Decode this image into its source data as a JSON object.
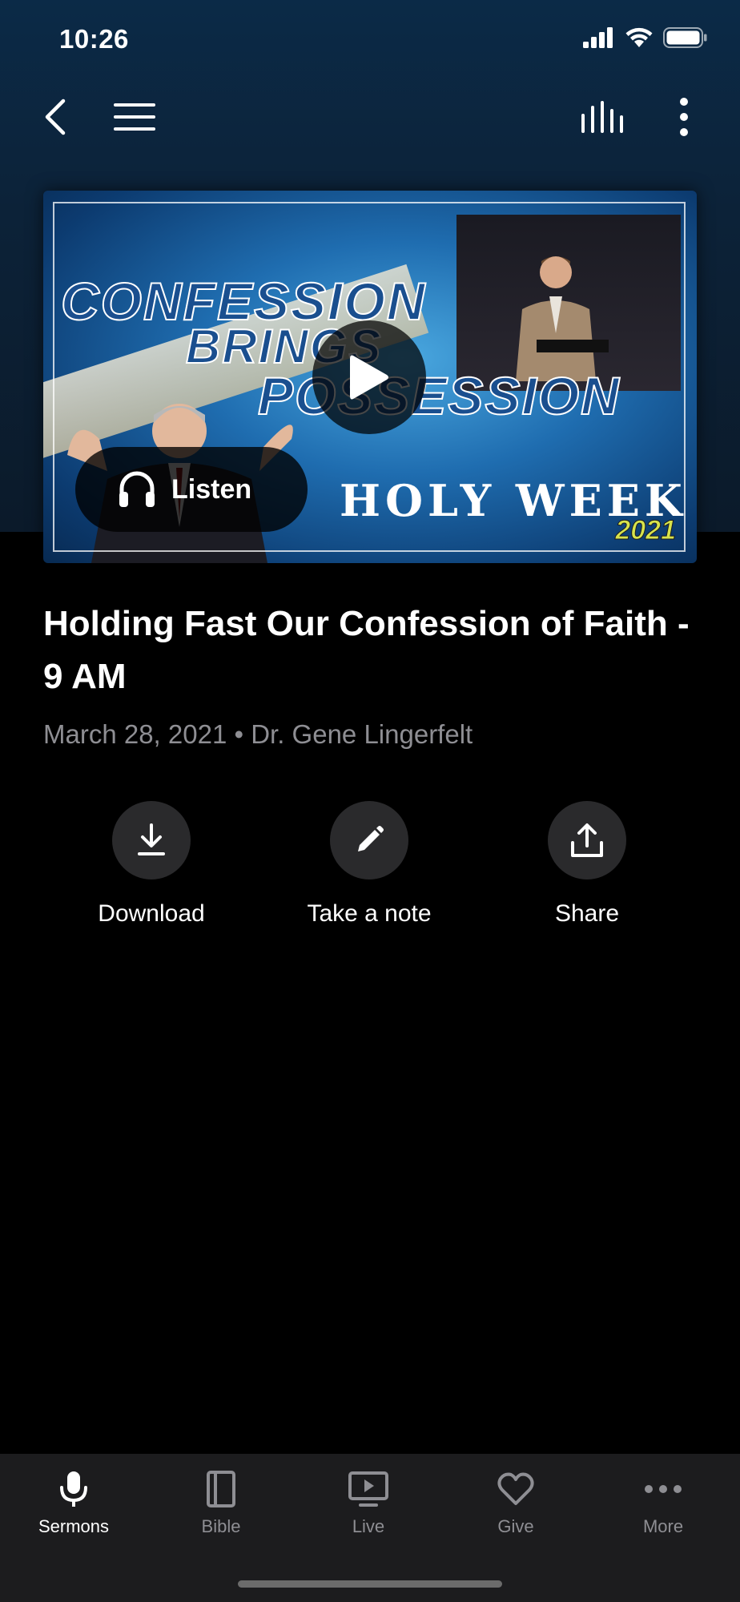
{
  "status": {
    "time": "10:26"
  },
  "artwork": {
    "line1": "CONFESSION",
    "line2": "BRINGS",
    "line3": "POSSESSION",
    "revival": "HOLY WEEK REVIVAL",
    "year": "2021"
  },
  "listen_label": "Listen",
  "sermon": {
    "title": "Holding Fast Our Confession of Faith - 9 AM",
    "date": "March 28, 2021",
    "separator": "•",
    "speaker": "Dr. Gene Lingerfelt"
  },
  "actions": {
    "download": "Download",
    "note": "Take a note",
    "share": "Share"
  },
  "tabs": {
    "sermons": "Sermons",
    "bible": "Bible",
    "live": "Live",
    "give": "Give",
    "more": "More"
  }
}
